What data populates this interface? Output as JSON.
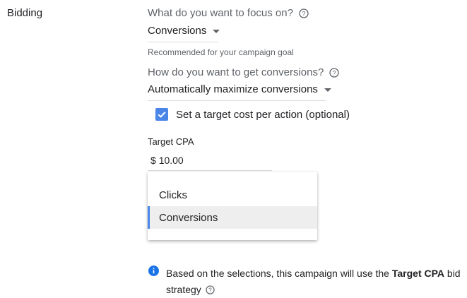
{
  "section": {
    "title": "Bidding"
  },
  "focus": {
    "question": "What do you want to focus on?",
    "selected": "Conversions",
    "hint": "Recommended for your campaign goal"
  },
  "method": {
    "question": "How do you want to get conversions?",
    "selected": "Automatically maximize conversions"
  },
  "target": {
    "checkbox_label": "Set a target cost per action (optional)",
    "checked": true,
    "field_label": "Target CPA",
    "currency": "$",
    "value": "10.00"
  },
  "dropdown": {
    "options": [
      "Clicks",
      "Conversions"
    ],
    "selected_index": 1
  },
  "info": {
    "text_before": "Based on the selections, this campaign will use the ",
    "strategy": "Target CPA",
    "text_after_1": " bid",
    "text_after_2": "strategy"
  },
  "colors": {
    "accent": "#4a86e8",
    "info_icon": "#1a73e8",
    "secondary_text": "#5f6368"
  },
  "icons": {
    "help": "help-circle-icon",
    "info": "info-icon",
    "check": "check-icon",
    "caret": "caret-down-icon"
  }
}
